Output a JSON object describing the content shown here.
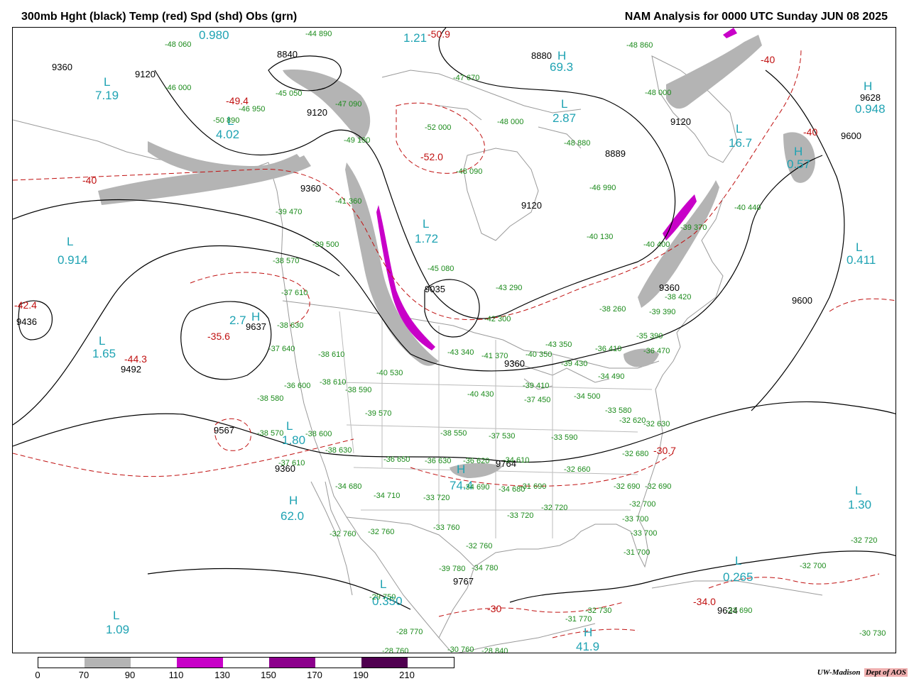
{
  "header": {
    "title_left": "300mb Hght (black) Temp (red) Spd (shd) Obs (grn)",
    "title_right": "NAM Analysis for 0000 UTC Sunday  JUN 08 2025"
  },
  "colors": {
    "height_contour": "#000000",
    "temp_contour": "#c01010",
    "obs_text": "#1a8a1a",
    "center_label": "#1fa3b3",
    "speed_70_90": "#b4b4b4",
    "speed_110_130": "#c800c8",
    "speed_150_170": "#8c008c",
    "speed_190_210": "#500050"
  },
  "legend": {
    "ticks": [
      "0",
      "70",
      "90",
      "110",
      "130",
      "150",
      "170",
      "190",
      "210"
    ],
    "shades": [
      {
        "from": "70",
        "to": "90",
        "color": "#b4b4b4"
      },
      {
        "from": "110",
        "to": "130",
        "color": "#c800c8"
      },
      {
        "from": "150",
        "to": "170",
        "color": "#8c008c"
      },
      {
        "from": "190",
        "to": "210",
        "color": "#500050"
      }
    ]
  },
  "credit": {
    "org": "UW-Madison",
    "dept": "Dept of AOS"
  },
  "height_labels": [
    "9360",
    "9120",
    "8840",
    "8880",
    "9120",
    "9120",
    "8889",
    "9120",
    "9628",
    "9600",
    "9360",
    "9035",
    "9360",
    "9600",
    "9436",
    "9637",
    "9492",
    "9360",
    "9567",
    "9360",
    "9764",
    "9767",
    "9624"
  ],
  "centers": [
    {
      "kind": "L",
      "value": "0.980"
    },
    {
      "kind": "L",
      "value": "7.19"
    },
    {
      "kind": "L",
      "value": "4.02"
    },
    {
      "kind": "L",
      "value": "1.21"
    },
    {
      "kind": "H",
      "value": "69.3"
    },
    {
      "kind": "L",
      "value": "2.87"
    },
    {
      "kind": "L",
      "value": "16.7"
    },
    {
      "kind": "H",
      "value": "0.948"
    },
    {
      "kind": "H",
      "value": "0.57"
    },
    {
      "kind": "L",
      "value": "1.72"
    },
    {
      "kind": "L",
      "value": "0.914"
    },
    {
      "kind": "L",
      "value": "0.411"
    },
    {
      "kind": "L",
      "value": "1.65"
    },
    {
      "kind": "H",
      "value": "2.7"
    },
    {
      "kind": "L",
      "value": "1.80"
    },
    {
      "kind": "H",
      "value": "62.0"
    },
    {
      "kind": "L",
      "value": "1.30"
    },
    {
      "kind": "L",
      "value": "0.265"
    },
    {
      "kind": "L",
      "value": "1.09"
    },
    {
      "kind": "L",
      "value": "0.350"
    },
    {
      "kind": "H",
      "value": "41.9"
    },
    {
      "kind": "H",
      "value": "74.4"
    }
  ],
  "temp_centers": [
    "-50.9",
    "-52.0",
    "-49.4",
    "-42.4",
    "-35.6",
    "-44.3",
    "-40",
    "-40",
    "-40",
    "-30",
    "-30.7",
    "-34.0"
  ],
  "observations": [
    "-48  060",
    "-46  000",
    "-46  950",
    "-44  890",
    "-45  050",
    "-50  890",
    "-49  190",
    "-47  090",
    "-47  670",
    "-52  000",
    "-48  000",
    "-48  000",
    "-48  860",
    "-48  880",
    "-48  090",
    "-46  990",
    "-40  130",
    "-41  360",
    "-39  470",
    "-39  500",
    "-40  440",
    "-39  370",
    "-40  400",
    "-38  570",
    "-45  080",
    "-43  290",
    "-37  610",
    "-38  630",
    "-42  300",
    "-38  260",
    "-37  640",
    "-38  610",
    "-40  530",
    "-39  390",
    "-38  420",
    "-35  390",
    "-36  410",
    "-43  340",
    "-41  370",
    "-40  350",
    "-43  350",
    "-39  430",
    "-34  490",
    "-36  470",
    "-36  600",
    "-38  610",
    "-38  590",
    "-40  430",
    "-39  410",
    "-37  450",
    "-34  500",
    "-33  580",
    "-32  620",
    "-32  630",
    "-38  580",
    "-39  570",
    "-38  570",
    "-38  600",
    "-38  550",
    "-37  530",
    "-33  590",
    "-32  680",
    "-38  630",
    "-37  610",
    "-36  650",
    "-36  630",
    "-36  620",
    "-34  610",
    "-32  690",
    "-32  660",
    "-34  680",
    "-34  710",
    "-33  720",
    "-34  690",
    "-34  680",
    "-31  690",
    "-32  720",
    "-32  690",
    "-32  700",
    "-32  760",
    "-32  760",
    "-33  760",
    "-33  720",
    "-32  760",
    "-33  700",
    "-33  700",
    "-31  700",
    "-39  780",
    "-34  780",
    "-32  720",
    "-32  700",
    "-29  750",
    "-28  770",
    "-28  760",
    "-30  760",
    "-28  840",
    "-31  770",
    "-32  730",
    "-33  690",
    "-30  730"
  ]
}
